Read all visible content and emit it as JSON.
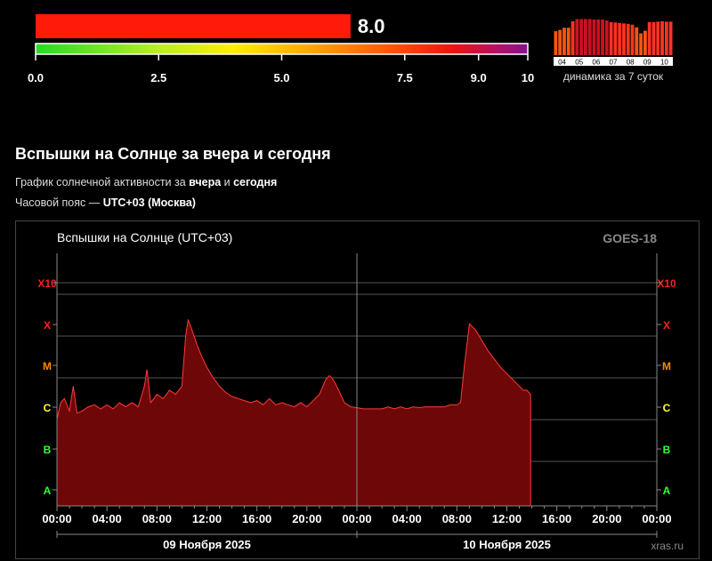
{
  "kp": {
    "value": 8.0,
    "value_label": "8.0",
    "scale_ticks": [
      "0.0",
      "2.5",
      "5.0",
      "7.5",
      "9.0",
      "10"
    ],
    "scale_tick_values": [
      0,
      2.5,
      5,
      7.5,
      9,
      10
    ],
    "max": 10,
    "fill_color": "#ff1a0a",
    "dynamics_label": "динамика за 7 суток",
    "dynamics_days": [
      "04",
      "05",
      "06",
      "07",
      "08",
      "09",
      "10"
    ],
    "dynamics_values": [
      5.5,
      5.8,
      6.3,
      6.3,
      7.8,
      8.3,
      8.3,
      8.3,
      8.3,
      8.2,
      8.2,
      8.2,
      8.0,
      7.6,
      7.5,
      7.4,
      7.3,
      7.2,
      7.0,
      6.4,
      5.0,
      5.6,
      7.6,
      7.6,
      7.7,
      7.8,
      7.7,
      7.7
    ]
  },
  "section": {
    "title": "Вспышки на Солнце за вчера и сегодня",
    "sub1_prefix": "График солнечной активности за ",
    "sub1_b1": "вчера",
    "sub1_mid": " и ",
    "sub1_b2": "сегодня",
    "sub2_prefix": "Часовой пояс — ",
    "sub2_b": "UTC+03 (Москва)"
  },
  "chart_data": {
    "type": "area",
    "title": "Вспышки на Солнце (UTC+03)",
    "source": "GOES-18",
    "watermark": "xras.ru",
    "y_classes": [
      "A",
      "B",
      "C",
      "M",
      "X",
      "X10"
    ],
    "y_class_colors": {
      "A": "#33ff33",
      "B": "#33ff33",
      "C": "#ffff33",
      "M": "#ff8800",
      "X": "#ff2020",
      "X10": "#ff2020"
    },
    "y_scale": "log",
    "x_tick_labels": [
      "00:00",
      "04:00",
      "08:00",
      "12:00",
      "16:00",
      "20:00",
      "00:00",
      "04:00",
      "08:00",
      "12:00",
      "16:00",
      "20:00",
      "00:00"
    ],
    "x_range_hours": [
      0,
      48
    ],
    "date_labels": [
      "09 Ноября 2025",
      "10 Ноября 2025"
    ],
    "series": [
      {
        "x_hours": [
          0,
          0.3,
          0.6,
          1.0,
          1.3,
          1.6,
          2.0,
          2.5,
          3.0,
          3.5,
          4.0,
          4.5,
          5.0,
          5.5,
          6.0,
          6.5,
          7.0,
          7.2,
          7.5,
          8.0,
          8.5,
          9.0,
          9.5,
          10.0,
          10.3,
          10.5,
          10.8,
          11.2,
          11.6,
          12.0,
          12.5,
          13.0,
          13.5,
          14.0,
          14.5,
          15.0,
          15.5,
          16.0,
          16.5,
          17.0,
          17.5,
          18.0,
          18.5,
          19.0,
          19.5,
          20.0,
          20.5,
          21.0,
          21.5,
          21.8,
          22.0,
          22.3,
          22.7,
          23.0,
          23.5,
          24.0,
          24.5,
          25.0,
          25.5,
          26.0,
          26.5,
          27.0,
          27.5,
          28.0,
          28.5,
          29.0,
          29.5,
          30.0,
          30.5,
          31.0,
          31.5,
          32.0,
          32.3,
          32.6,
          33.0,
          33.5,
          34.0,
          34.5,
          35.0,
          35.5,
          36.0,
          36.5,
          37.0,
          37.3,
          37.6,
          37.9
        ],
        "values": [
          2.7,
          3.1,
          3.2,
          2.9,
          3.5,
          2.85,
          2.9,
          3.0,
          3.05,
          2.95,
          3.05,
          2.95,
          3.1,
          3.0,
          3.1,
          3.0,
          3.5,
          3.9,
          3.1,
          3.3,
          3.2,
          3.4,
          3.3,
          3.5,
          4.7,
          5.1,
          4.85,
          4.5,
          4.2,
          3.95,
          3.7,
          3.5,
          3.35,
          3.25,
          3.2,
          3.15,
          3.1,
          3.15,
          3.05,
          3.2,
          3.05,
          3.1,
          3.05,
          3.0,
          3.1,
          3.0,
          3.15,
          3.3,
          3.65,
          3.75,
          3.7,
          3.55,
          3.3,
          3.1,
          3.0,
          2.98,
          2.95,
          2.95,
          2.95,
          2.95,
          3.0,
          2.95,
          3.0,
          2.95,
          3.0,
          2.98,
          3.0,
          3.0,
          3.0,
          3.0,
          3.05,
          3.05,
          3.1,
          4.0,
          5.0,
          4.85,
          4.6,
          4.35,
          4.15,
          3.95,
          3.8,
          3.65,
          3.5,
          3.4,
          3.4,
          3.3
        ]
      }
    ]
  }
}
